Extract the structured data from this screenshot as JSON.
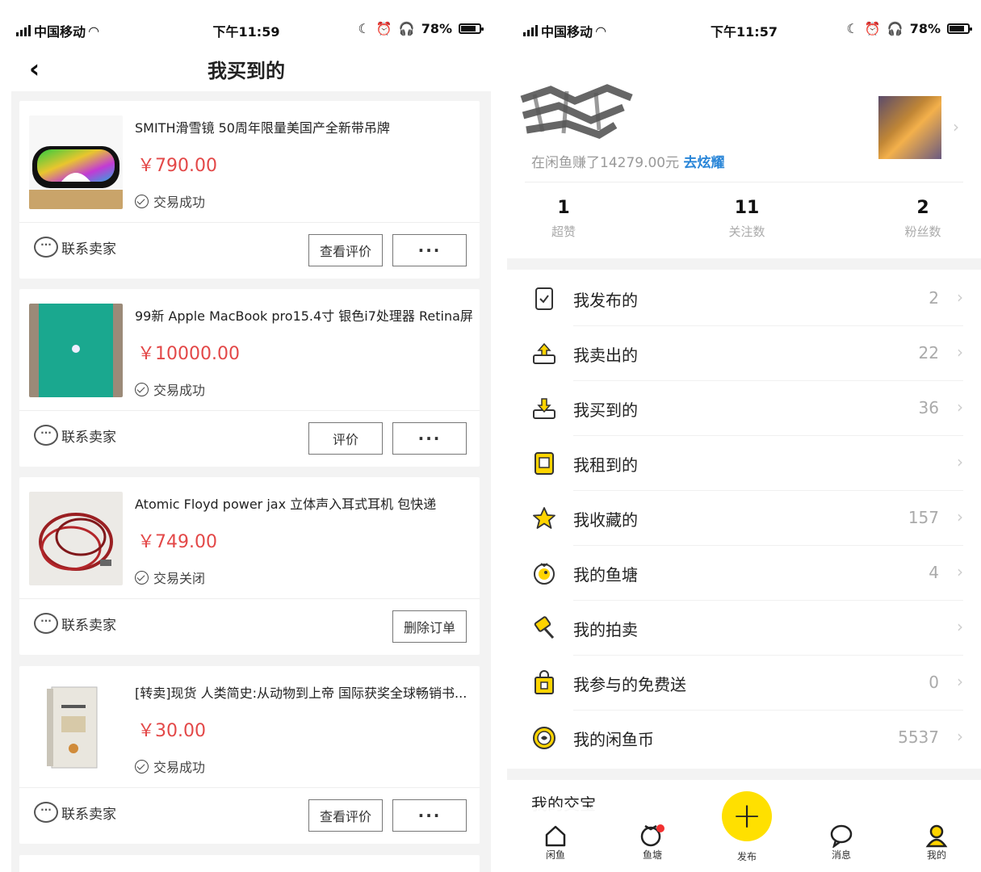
{
  "left": {
    "status": {
      "carrier": "中国移动",
      "time": "下午11:59",
      "battery": "78%"
    },
    "nav": {
      "back": "‹",
      "title": "我买到的"
    },
    "orders": [
      {
        "title": "SMITH滑雪镜 50周年限量美国产全新带吊牌",
        "price": "￥790.00",
        "status": "交易成功",
        "contact": "联系卖家",
        "action": "查看评价",
        "more": "···"
      },
      {
        "title": "99新 Apple MacBook pro15.4寸 银色i7处理器 Retina屏",
        "price": "￥10000.00",
        "status": "交易成功",
        "contact": "联系卖家",
        "action": "评价",
        "more": "···"
      },
      {
        "title": "Atomic Floyd power jax 立体声入耳式耳机 包快递",
        "price": "￥749.00",
        "status": "交易关闭",
        "contact": "联系卖家",
        "action": "删除订单"
      },
      {
        "title": "[转卖]现货 人类简史:从动物到上帝 国际获奖全球畅销书...",
        "price": "￥30.00",
        "status": "交易成功",
        "contact": "联系卖家",
        "action": "查看评价",
        "more": "···"
      }
    ]
  },
  "right": {
    "status": {
      "carrier": "中国移动",
      "time": "下午11:57",
      "battery": "78%"
    },
    "user": {
      "earned_text": "在闲鱼赚了14279.00元",
      "show_off": "去炫耀"
    },
    "stats": [
      {
        "num": "1",
        "label": "超赞"
      },
      {
        "num": "11",
        "label": "关注数"
      },
      {
        "num": "2",
        "label": "粉丝数"
      }
    ],
    "menu": [
      {
        "label": "我发布的",
        "count": "2"
      },
      {
        "label": "我卖出的",
        "count": "22"
      },
      {
        "label": "我买到的",
        "count": "36"
      },
      {
        "label": "我租到的",
        "count": ""
      },
      {
        "label": "我收藏的",
        "count": "157"
      },
      {
        "label": "我的鱼塘",
        "count": "4"
      },
      {
        "label": "我的拍卖",
        "count": ""
      },
      {
        "label": "我参与的免费送",
        "count": "0"
      },
      {
        "label": "我的闲鱼币",
        "count": "5537"
      }
    ],
    "peek_label": "我的交宝",
    "tabs": {
      "home": "闲鱼",
      "pond": "鱼塘",
      "publish": "发布",
      "messages": "消息",
      "mine": "我的"
    },
    "accent": "#ffe000"
  }
}
